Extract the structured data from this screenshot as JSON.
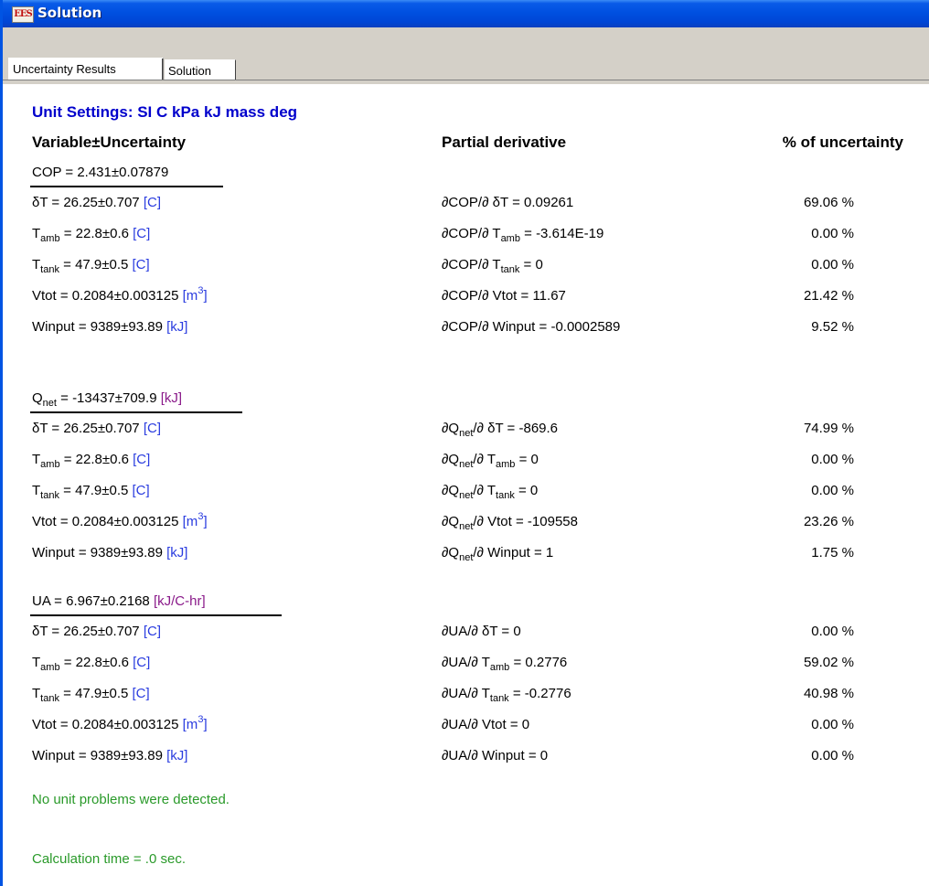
{
  "window": {
    "title": "Solution",
    "icon": "ees-app-icon"
  },
  "tabs": [
    {
      "label": "Uncertainty Results",
      "active": true
    },
    {
      "label": "Solution",
      "active": false
    }
  ],
  "unit_settings": "Unit Settings: SI C kPa kJ mass deg",
  "headers": {
    "variable": "Variable±Uncertainty",
    "partial": "Partial derivative",
    "percent": "% of uncertainty"
  },
  "sections": [
    {
      "result": {
        "name": "COP",
        "sub": "",
        "expr": " = 2.431±0.07879",
        "unit": ""
      },
      "rows": [
        {
          "var": "δT",
          "var_sub": "",
          "value": "  = 26.25±0.707",
          "unit": "[C]",
          "unit_sup": "",
          "unit_close": "",
          "deriv_pre": "∂COP/∂ δT",
          "deriv_sub": "",
          "deriv_post": "",
          "deriv_val": "  = 0.09261",
          "pct": "69.06 %"
        },
        {
          "var": "T",
          "var_sub": "amb",
          "value": " = 22.8±0.6",
          "unit": "[C]",
          "unit_sup": "",
          "unit_close": "",
          "deriv_pre": "∂COP/∂ T",
          "deriv_sub": "amb",
          "deriv_post": "",
          "deriv_val": " = -3.614E-19",
          "pct": "0.00 %"
        },
        {
          "var": "T",
          "var_sub": "tank",
          "value": "  = 47.9±0.5",
          "unit": "[C]",
          "unit_sup": "",
          "unit_close": "",
          "deriv_pre": "∂COP/∂ T",
          "deriv_sub": "tank",
          "deriv_post": "",
          "deriv_val": "  = 0",
          "pct": "0.00 %"
        },
        {
          "var": "Vtot",
          "var_sub": "",
          "value": "  = 0.2084±0.003125",
          "unit": "[m",
          "unit_sup": "3",
          "unit_close": "]",
          "deriv_pre": "∂COP/∂ Vtot",
          "deriv_sub": "",
          "deriv_post": "",
          "deriv_val": "  = 11.67",
          "pct": "21.42 %"
        },
        {
          "var": "Winput",
          "var_sub": "",
          "value": " = 9389±93.89",
          "unit": "[kJ]",
          "unit_sup": "",
          "unit_close": "",
          "deriv_pre": "∂COP/∂ Winput",
          "deriv_sub": "",
          "deriv_post": "",
          "deriv_val": " = -0.0002589",
          "pct": "9.52 %"
        }
      ]
    },
    {
      "result": {
        "name": "Q",
        "sub": "net",
        "expr": " = -13437±709.9",
        "unit": "[kJ]"
      },
      "rows": [
        {
          "var": "δT",
          "var_sub": "",
          "value": "  = 26.25±0.707",
          "unit": "[C]",
          "unit_sup": "",
          "unit_close": "",
          "deriv_pre": "∂Q",
          "deriv_sub": "net",
          "deriv_post": "/∂ δT",
          "deriv_val": "  = -869.6",
          "pct": "74.99 %"
        },
        {
          "var": "T",
          "var_sub": "amb",
          "value": " = 22.8±0.6",
          "unit": "[C]",
          "unit_sup": "",
          "unit_close": "",
          "deriv_pre": "∂Q",
          "deriv_sub": "net",
          "deriv_post": "/∂ T",
          "deriv_sub2": "amb",
          "deriv_val": " = 0",
          "pct": "0.00 %"
        },
        {
          "var": "T",
          "var_sub": "tank",
          "value": "  = 47.9±0.5",
          "unit": "[C]",
          "unit_sup": "",
          "unit_close": "",
          "deriv_pre": "∂Q",
          "deriv_sub": "net",
          "deriv_post": "/∂ T",
          "deriv_sub2": "tank",
          "deriv_val": "  = 0",
          "pct": "0.00 %"
        },
        {
          "var": "Vtot",
          "var_sub": "",
          "value": "  = 0.2084±0.003125",
          "unit": "[m",
          "unit_sup": "3",
          "unit_close": "]",
          "deriv_pre": "∂Q",
          "deriv_sub": "net",
          "deriv_post": "/∂ Vtot",
          "deriv_val": "  = -109558",
          "pct": "23.26 %"
        },
        {
          "var": "Winput",
          "var_sub": "",
          "value": " = 9389±93.89",
          "unit": "[kJ]",
          "unit_sup": "",
          "unit_close": "",
          "deriv_pre": "∂Q",
          "deriv_sub": "net",
          "deriv_post": "/∂ Winput",
          "deriv_val": " = 1",
          "pct": "1.75 %"
        }
      ]
    },
    {
      "result": {
        "name": "UA",
        "sub": "",
        "expr": " = 6.967±0.2168",
        "unit": "[kJ/C-hr]"
      },
      "rows": [
        {
          "var": "δT",
          "var_sub": "",
          "value": "  = 26.25±0.707",
          "unit": "[C]",
          "unit_sup": "",
          "unit_close": "",
          "deriv_pre": "∂UA/∂ δT",
          "deriv_sub": "",
          "deriv_post": "",
          "deriv_val": "  = 0",
          "pct": "0.00 %"
        },
        {
          "var": "T",
          "var_sub": "amb",
          "value": " = 22.8±0.6",
          "unit": "[C]",
          "unit_sup": "",
          "unit_close": "",
          "deriv_pre": "∂UA/∂ T",
          "deriv_sub": "amb",
          "deriv_post": "",
          "deriv_val": " = 0.2776",
          "pct": "59.02 %"
        },
        {
          "var": "T",
          "var_sub": "tank",
          "value": "  = 47.9±0.5",
          "unit": "[C]",
          "unit_sup": "",
          "unit_close": "",
          "deriv_pre": "∂UA/∂ T",
          "deriv_sub": "tank",
          "deriv_post": "",
          "deriv_val": "  = -0.2776",
          "pct": "40.98 %"
        },
        {
          "var": "Vtot",
          "var_sub": "",
          "value": "  = 0.2084±0.003125",
          "unit": "[m",
          "unit_sup": "3",
          "unit_close": "]",
          "deriv_pre": "∂UA/∂ Vtot",
          "deriv_sub": "",
          "deriv_post": "",
          "deriv_val": "  = 0",
          "pct": "0.00 %"
        },
        {
          "var": "Winput",
          "var_sub": "",
          "value": " = 9389±93.89",
          "unit": "[kJ]",
          "unit_sup": "",
          "unit_close": "",
          "deriv_pre": "∂UA/∂ Winput",
          "deriv_sub": "",
          "deriv_post": "",
          "deriv_val": " = 0",
          "pct": "0.00 %"
        }
      ]
    }
  ],
  "messages": {
    "unit_check": "No unit problems were detected.",
    "calc_time": "Calculation time = .0 sec."
  },
  "colors": {
    "title_bar": "#0050e0",
    "unit_settings": "#0000cc",
    "unit_blue": "#2a3cdf",
    "unit_purple": "#8a1a8a",
    "message_green": "#2a9a2a"
  }
}
